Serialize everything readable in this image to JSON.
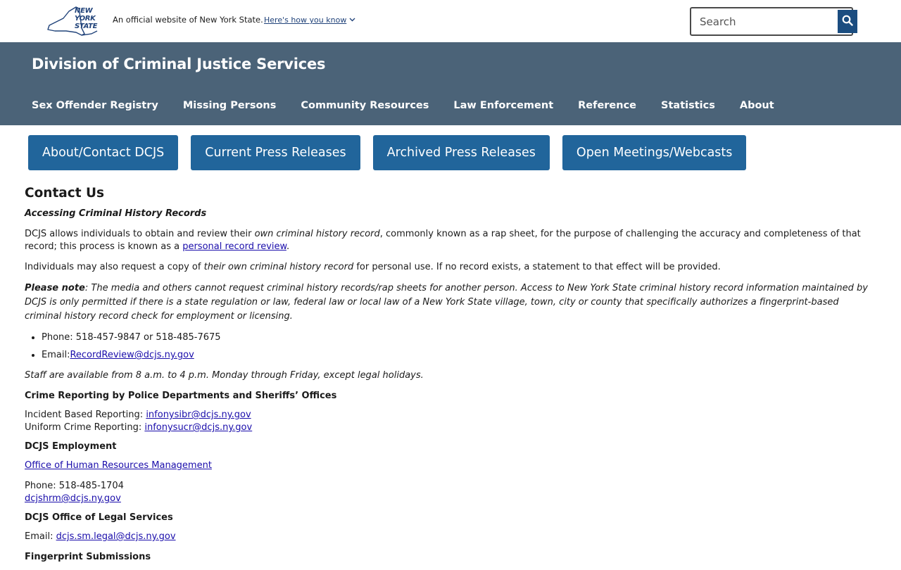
{
  "topbar": {
    "logo_text": [
      "NEW",
      "YORK",
      "STATE"
    ],
    "official_text": "An official website of New York State.",
    "howknow_text": "Here's how you know",
    "search_placeholder": "Search"
  },
  "agency": {
    "title": "Division of Criminal Justice Services",
    "nav": [
      "Sex Offender Registry",
      "Missing Persons",
      "Community Resources",
      "Law Enforcement",
      "Reference",
      "Statistics",
      "About"
    ]
  },
  "subnav": [
    "About/Contact DCJS",
    "Current Press Releases",
    "Archived Press Releases",
    "Open Meetings/Webcasts"
  ],
  "content": {
    "title": "Contact Us",
    "access_heading": "Accessing Criminal History Records",
    "p1_a": "DCJS allows individuals to obtain and review their ",
    "p1_b": "own criminal history record",
    "p1_c": ", commonly known as a rap sheet, for the purpose of challenging the accuracy and completeness of that record; this process is known as a ",
    "p1_link": "personal record review",
    "p1_d": ".",
    "p2_a": "Individuals may also request a copy of ",
    "p2_b": "their own criminal history record",
    "p2_c": " for personal use. If no record exists, a statement to that effect will be provided.",
    "note_label": "Please note",
    "note_text": ": The media and others cannot request criminal history records/rap sheets for another person. Access to New York State criminal history record information maintained by DCJS is only permitted if there is a state regulation or law, federal law or local law of a New York State village, town, city or county that specifically authorizes a fingerprint-based criminal history record check for employment or licensing.",
    "phone_label": "Phone: 518-457-9847 or 518-485-7675",
    "email_label": "Email:",
    "email_link": "RecordReview@dcjs.ny.gov",
    "staff_text": "Staff are available from 8 a.m. to 4 p.m. Monday through Friday, except legal holidays.",
    "crime_heading": "Crime Reporting by Police Departments and Sheriffs’ Offices",
    "ibr_label": "Incident Based Reporting: ",
    "ibr_link": "infonysibr@dcjs.ny.gov",
    "ucr_label": "Uniform Crime Reporting: ",
    "ucr_link": "infonysucr@dcjs.ny.gov",
    "employment_heading": "DCJS Employment",
    "hr_link": "Office of Human Resources Management",
    "hr_phone": "Phone: 518-485-1704",
    "hr_email": "dcjshrm@dcjs.ny.gov",
    "legal_heading": "DCJS Office of Legal Services",
    "legal_label": "Email: ",
    "legal_link": "dcjs.sm.legal@dcjs.ny.gov",
    "fingerprint_heading": "Fingerprint Submissions"
  }
}
